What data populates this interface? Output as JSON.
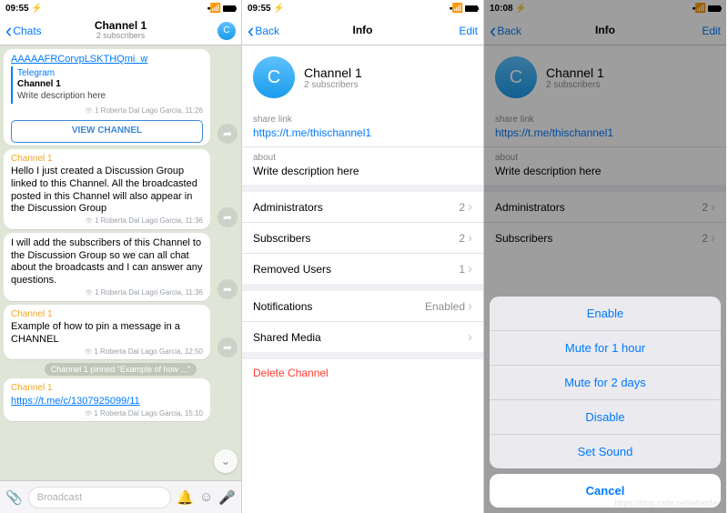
{
  "status": {
    "t1": "09:55 ⚡",
    "t2": "09:55 ⚡",
    "t3": "10:08 ⚡",
    "wifi": "📶"
  },
  "s1": {
    "back": "Chats",
    "title": "Channel 1",
    "sub": "2 subscribers",
    "avatar": "C",
    "link0": "AAAAAFRCorvpLSKTHQmi_w",
    "quote": {
      "src": "Telegram",
      "title": "Channel 1",
      "desc": "Write description here"
    },
    "quote_meta": "1 Roberta Dal Lago Garcia, 11:26",
    "viewch": "VIEW CHANNEL",
    "m1_sender": "Channel 1",
    "m1": "Hello I just created a Discussion Group linked to this Channel. All the broadcasted posted in this Channel will also appear in the Discussion Group",
    "m1_meta": "1 Roberta Dal Lago Garcia, 11:36",
    "m2": "I will add the subscribers of this Channel to the Discussion Group so we can all chat about the broadcasts and I can answer any questions.",
    "m2_meta": "1 Roberta Dal Lago Garcia, 11:36",
    "m3_sender": "Channel 1",
    "m3": "Example of how to pin a message in a CHANNEL",
    "m3_meta": "1 Roberta Dal Lago Garcia, 12:50",
    "pin": "Channel 1 pinned \"Example of how ...\"",
    "m4_sender": "Channel 1",
    "m4_link": "https://t.me/c/1307925099/11",
    "m4_meta": "1 Roberta Dal Lago Garcia, 15:10",
    "broadcast": "Broadcast"
  },
  "s2": {
    "back": "Back",
    "title": "Info",
    "edit": "Edit",
    "avatar": "C",
    "name": "Channel 1",
    "subs": "2 subscribers",
    "share_h": "share link",
    "share_link": "https://t.me/thischannel1",
    "about_h": "about",
    "about": "Write description here",
    "admins": "Administrators",
    "admins_v": "2",
    "subs_l": "Subscribers",
    "subs_v": "2",
    "rem": "Removed Users",
    "rem_v": "1",
    "notif": "Notifications",
    "notif_v": "Enabled",
    "media": "Shared Media",
    "del": "Delete Channel"
  },
  "s3": {
    "back": "Back",
    "title": "Info",
    "edit": "Edit",
    "avatar": "C",
    "name": "Channel 1",
    "subs": "2 subscribers",
    "share_h": "share link",
    "share_link": "https://t.me/thischannel1",
    "about_h": "about",
    "about": "Write description here",
    "admins": "Administrators",
    "admins_v": "2",
    "subs_l": "Subscribers",
    "subs_v": "2",
    "sheet": [
      "Enable",
      "Mute for 1 hour",
      "Mute for 2 days",
      "Disable",
      "Set Sound"
    ],
    "cancel": "Cancel"
  },
  "watermark": "https://blog.csdn.net/whatday"
}
